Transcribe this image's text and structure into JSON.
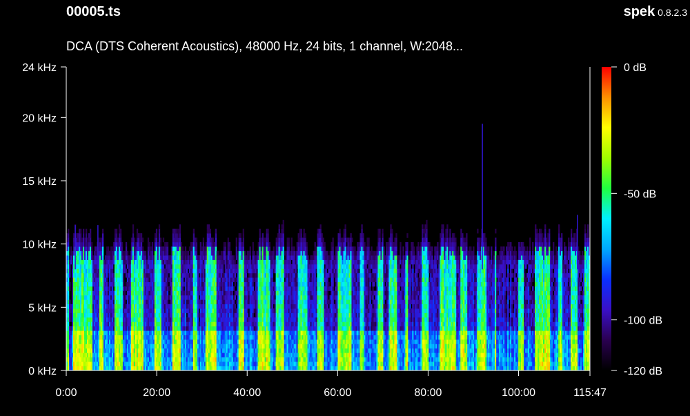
{
  "header": {
    "file_name": "00005.ts",
    "app_name": "spek",
    "app_version": "0.8.2.3",
    "stream_info": "DCA (DTS Coherent Acoustics), 48000 Hz, 24 bits, 1 channel, W:2048..."
  },
  "colors": {
    "background": "#000000",
    "text": "#ffffff",
    "palette": [
      "#000000",
      "#2a0050",
      "#3a10c8",
      "#0a30ff",
      "#00a8ff",
      "#00f0ff",
      "#20ff40",
      "#a0ff00",
      "#ffff00",
      "#ff9000",
      "#ff0000"
    ]
  },
  "chart_data": {
    "type": "heatmap",
    "title": "",
    "xlabel": "",
    "ylabel": "",
    "x_unit": "minutes",
    "xlim": [
      0,
      115.78
    ],
    "x_tick_labels": [
      "0:00",
      "20:00",
      "40:00",
      "60:00",
      "80:00",
      "100:00",
      "115:47"
    ],
    "x_tick_values": [
      0,
      20,
      40,
      60,
      80,
      100,
      115.78
    ],
    "y_unit": "kHz",
    "ylim": [
      0,
      24
    ],
    "y_tick_labels": [
      "0 kHz",
      "5 kHz",
      "10 kHz",
      "15 kHz",
      "20 kHz",
      "24 kHz"
    ],
    "y_tick_values": [
      0,
      5,
      10,
      15,
      20,
      24
    ],
    "colorbar": {
      "range_db": [
        -120,
        0
      ],
      "tick_labels": [
        "0 dB",
        "-50 dB",
        "-100 dB",
        "-120 dB"
      ],
      "tick_values": [
        0,
        -50,
        -100,
        -120
      ]
    },
    "spectral_cutoff_khz_approx": 9,
    "bursts_khz_approx": [
      {
        "minute": 2,
        "khz": 11.5
      },
      {
        "minute": 7,
        "khz": 11.5
      },
      {
        "minute": 92,
        "khz": 19.5
      },
      {
        "minute": 113,
        "khz": 12.3
      }
    ],
    "grid": false,
    "legend": "colorbar-right"
  }
}
